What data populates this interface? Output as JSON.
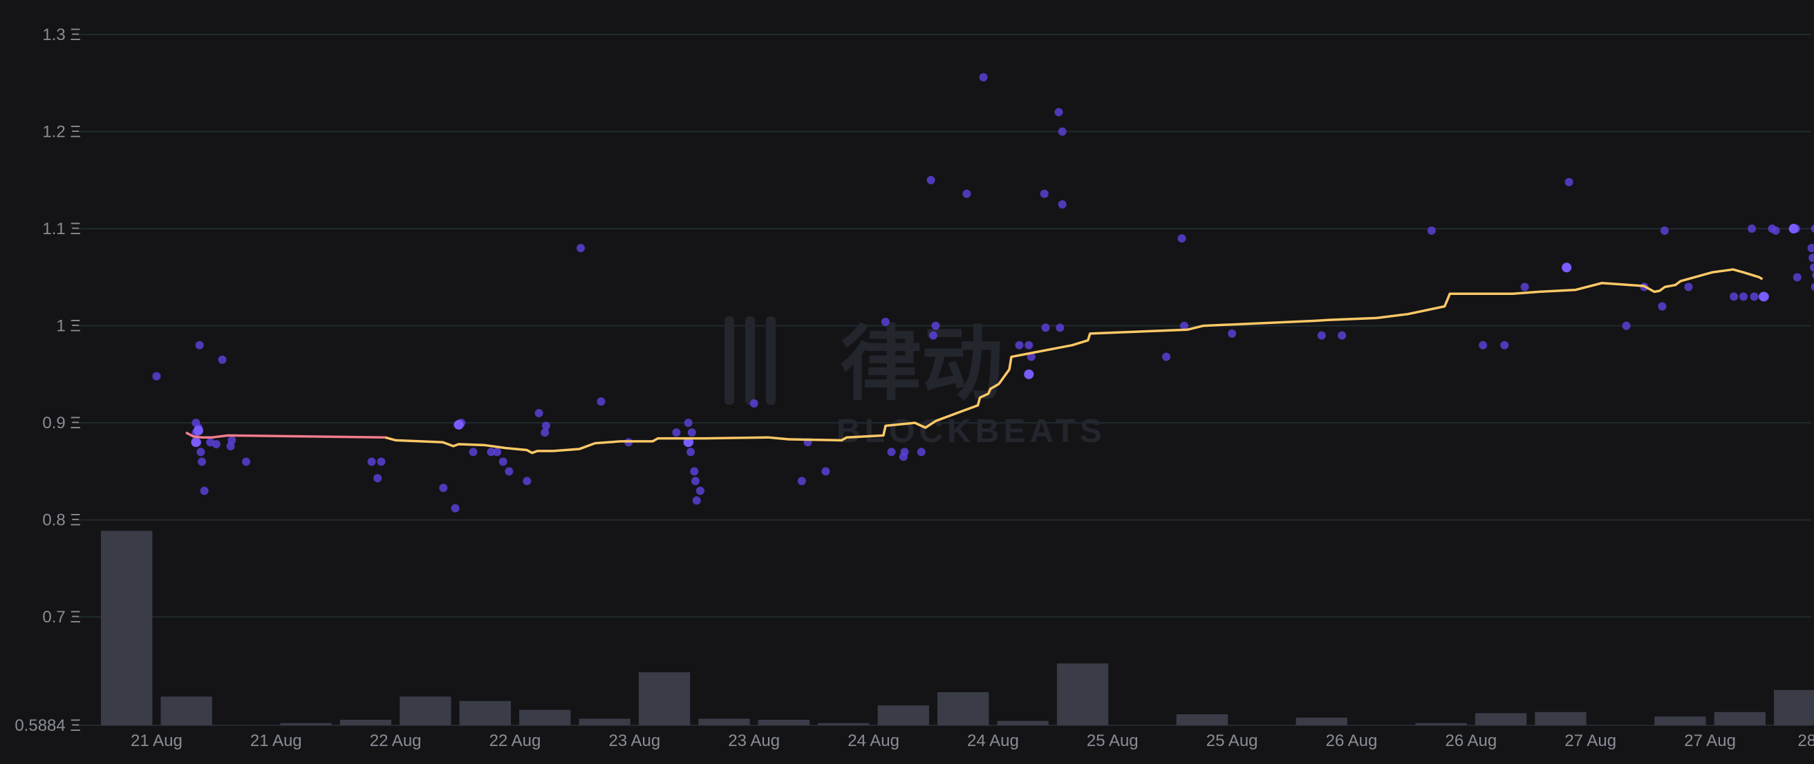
{
  "watermark": {
    "cn": "律动",
    "en": "BLOCKBEATS"
  },
  "colors": {
    "background": "#141417",
    "grid": "#1f2a2e",
    "scatter": "#5b3fd6",
    "scatter_highlight": "#7b5cff",
    "floor_line": "#ffc966",
    "floor_line_start": "#f47c8c",
    "volume_bar": "#3a3d48"
  },
  "chart_data": {
    "type": "scatter",
    "title": "",
    "xlabel": "",
    "ylabel": "",
    "ylim": [
      0.5884,
      1.3
    ],
    "y_ticks": [
      "0.5884 Ξ",
      "0.7 Ξ",
      "0.8 Ξ",
      "0.9 Ξ",
      "1 Ξ",
      "1.1 Ξ",
      "1.2 Ξ",
      "1.3 Ξ"
    ],
    "y_tick_values": [
      0.5884,
      0.7,
      0.8,
      0.9,
      1.0,
      1.1,
      1.2,
      1.3
    ],
    "xlim": [
      0,
      14
    ],
    "x_ticks": [
      "21 Aug",
      "21 Aug",
      "22 Aug",
      "22 Aug",
      "23 Aug",
      "23 Aug",
      "24 Aug",
      "24 Aug",
      "25 Aug",
      "25 Aug",
      "26 Aug",
      "26 Aug",
      "27 Aug",
      "27 Aug",
      "28 Aug"
    ],
    "x_tick_values": [
      0.5,
      1.5,
      2.5,
      3.5,
      4.5,
      5.5,
      6.5,
      7.5,
      8.5,
      9.5,
      10.5,
      11.5,
      12.5,
      13.5,
      14.45
    ],
    "grid": true,
    "series": [
      {
        "kind": "sales",
        "points": [
          [
            0.5,
            0.948
          ],
          [
            0.83,
            0.9
          ],
          [
            0.83,
            0.89
          ],
          [
            0.84,
            0.88
          ],
          [
            0.85,
            0.895
          ],
          [
            0.87,
            0.87
          ],
          [
            0.88,
            0.86
          ],
          [
            0.9,
            0.83
          ],
          [
            0.86,
            0.98
          ],
          [
            0.95,
            0.88
          ],
          [
            1.0,
            0.878
          ],
          [
            1.05,
            0.965
          ],
          [
            1.12,
            0.876
          ],
          [
            1.13,
            0.882
          ],
          [
            1.25,
            0.86
          ],
          [
            2.3,
            0.86
          ],
          [
            2.35,
            0.843
          ],
          [
            2.38,
            0.86
          ],
          [
            2.9,
            0.833
          ],
          [
            3.0,
            0.812
          ],
          [
            3.02,
            0.898
          ],
          [
            3.05,
            0.9
          ],
          [
            3.15,
            0.87
          ],
          [
            3.3,
            0.87
          ],
          [
            3.35,
            0.87
          ],
          [
            3.4,
            0.86
          ],
          [
            3.45,
            0.85
          ],
          [
            3.6,
            0.84
          ],
          [
            3.7,
            0.91
          ],
          [
            3.75,
            0.89
          ],
          [
            3.76,
            0.897
          ],
          [
            4.05,
            1.08
          ],
          [
            4.22,
            0.922
          ],
          [
            4.45,
            0.88
          ],
          [
            4.85,
            0.89
          ],
          [
            4.95,
            0.9
          ],
          [
            4.96,
            0.88
          ],
          [
            4.97,
            0.87
          ],
          [
            4.98,
            0.89
          ],
          [
            5.0,
            0.85
          ],
          [
            5.01,
            0.84
          ],
          [
            5.02,
            0.82
          ],
          [
            5.05,
            0.83
          ],
          [
            5.5,
            0.92
          ],
          [
            5.9,
            0.84
          ],
          [
            5.95,
            0.88
          ],
          [
            6.1,
            0.85
          ],
          [
            6.6,
            1.004
          ],
          [
            6.65,
            0.87
          ],
          [
            6.75,
            0.865
          ],
          [
            6.76,
            0.87
          ],
          [
            6.9,
            0.87
          ],
          [
            6.98,
            1.15
          ],
          [
            7.0,
            0.99
          ],
          [
            7.02,
            1.0
          ],
          [
            7.28,
            1.136
          ],
          [
            7.42,
            1.256
          ],
          [
            7.72,
            0.98
          ],
          [
            7.8,
            0.98
          ],
          [
            7.82,
            0.968
          ],
          [
            7.8,
            0.95
          ],
          [
            7.93,
            1.136
          ],
          [
            7.94,
            0.998
          ],
          [
            8.05,
            1.22
          ],
          [
            8.08,
            1.2
          ],
          [
            8.06,
            0.998
          ],
          [
            8.08,
            1.125
          ],
          [
            8.95,
            0.968
          ],
          [
            9.08,
            1.09
          ],
          [
            9.1,
            1.0
          ],
          [
            9.5,
            0.992
          ],
          [
            10.25,
            0.99
          ],
          [
            10.42,
            0.99
          ],
          [
            11.17,
            1.098
          ],
          [
            11.6,
            0.98
          ],
          [
            11.78,
            0.98
          ],
          [
            11.95,
            1.04
          ],
          [
            12.3,
            1.06
          ],
          [
            12.32,
            1.148
          ],
          [
            12.8,
            1.0
          ],
          [
            12.95,
            1.04
          ],
          [
            13.1,
            1.02
          ],
          [
            13.12,
            1.098
          ],
          [
            13.32,
            1.04
          ],
          [
            13.7,
            1.03
          ],
          [
            13.78,
            1.03
          ],
          [
            13.85,
            1.1
          ],
          [
            13.87,
            1.03
          ],
          [
            13.94,
            1.03
          ],
          [
            13.96,
            1.03
          ],
          [
            14.02,
            1.1
          ],
          [
            14.05,
            1.098
          ],
          [
            14.2,
            1.1
          ],
          [
            14.22,
            1.1
          ],
          [
            14.23,
            1.05
          ],
          [
            14.38,
            1.1
          ],
          [
            14.35,
            1.08
          ],
          [
            14.36,
            1.07
          ],
          [
            14.37,
            1.06
          ],
          [
            14.38,
            1.04
          ],
          [
            14.39,
            1.052
          ]
        ],
        "highlighted": [
          [
            0.83,
            0.88
          ],
          [
            0.85,
            0.892
          ],
          [
            3.03,
            0.898
          ],
          [
            4.95,
            0.88
          ],
          [
            7.8,
            0.95
          ],
          [
            12.3,
            1.06
          ],
          [
            13.95,
            1.03
          ],
          [
            14.2,
            1.1
          ]
        ]
      },
      {
        "kind": "floor_price",
        "points": [
          [
            0.85,
            0.89
          ],
          [
            0.92,
            0.886
          ],
          [
            1.0,
            0.885
          ],
          [
            1.1,
            0.885
          ],
          [
            1.25,
            0.887
          ],
          [
            2.75,
            0.885
          ],
          [
            2.85,
            0.882
          ],
          [
            3.3,
            0.88
          ],
          [
            3.4,
            0.876
          ],
          [
            3.45,
            0.878
          ],
          [
            3.7,
            0.877
          ],
          [
            3.9,
            0.874
          ],
          [
            4.1,
            0.872
          ],
          [
            4.15,
            0.869
          ],
          [
            4.2,
            0.871
          ],
          [
            4.35,
            0.871
          ],
          [
            4.6,
            0.873
          ],
          [
            4.75,
            0.879
          ],
          [
            5.0,
            0.881
          ],
          [
            5.3,
            0.881
          ],
          [
            5.35,
            0.884
          ],
          [
            5.8,
            0.884
          ],
          [
            6.4,
            0.885
          ],
          [
            6.6,
            0.883
          ],
          [
            7.1,
            0.882
          ],
          [
            7.15,
            0.885
          ],
          [
            7.5,
            0.887
          ],
          [
            7.52,
            0.897
          ],
          [
            7.8,
            0.9
          ],
          [
            7.9,
            0.895
          ],
          [
            8.0,
            0.902
          ],
          [
            8.4,
            0.918
          ],
          [
            8.42,
            0.926
          ],
          [
            8.5,
            0.93
          ],
          [
            8.52,
            0.935
          ],
          [
            8.6,
            0.94
          ],
          [
            8.7,
            0.955
          ],
          [
            8.72,
            0.968
          ],
          [
            9.3,
            0.98
          ],
          [
            9.45,
            0.985
          ],
          [
            9.47,
            0.992
          ],
          [
            10.4,
            0.996
          ],
          [
            10.55,
            1.0
          ],
          [
            11.6,
            1.005
          ],
          [
            11.75,
            1.006
          ],
          [
            12.2,
            1.008
          ],
          [
            12.5,
            1.012
          ],
          [
            12.85,
            1.02
          ],
          [
            12.87,
            1.025
          ],
          [
            12.9,
            1.033
          ],
          [
            13.5,
            1.033
          ],
          [
            13.75,
            1.035
          ],
          [
            14.1,
            1.037
          ],
          [
            14.35,
            1.044
          ],
          [
            14.75,
            1.041
          ],
          [
            14.85,
            1.035
          ],
          [
            14.9,
            1.036
          ],
          [
            14.95,
            1.04
          ],
          [
            15.05,
            1.042
          ],
          [
            15.1,
            1.046
          ],
          [
            15.4,
            1.055
          ],
          [
            15.6,
            1.058
          ],
          [
            15.7,
            1.055
          ],
          [
            15.85,
            1.05
          ],
          [
            15.88,
            1.048
          ]
        ]
      }
    ],
    "volume": {
      "x_start": 0,
      "bin_width": 0.5,
      "values": [
        0.88,
        0.13,
        0,
        0.01,
        0.025,
        0.13,
        0.11,
        0.07,
        0.03,
        0.24,
        0.03,
        0.025,
        0.01,
        0.09,
        0.15,
        0.02,
        0.28,
        0,
        0.05,
        0,
        0.035,
        0,
        0.01,
        0.055,
        0.06,
        0,
        0.04,
        0.06,
        0.16,
        0.22,
        0.02,
        0
      ],
      "max_fraction": 0.32
    }
  }
}
